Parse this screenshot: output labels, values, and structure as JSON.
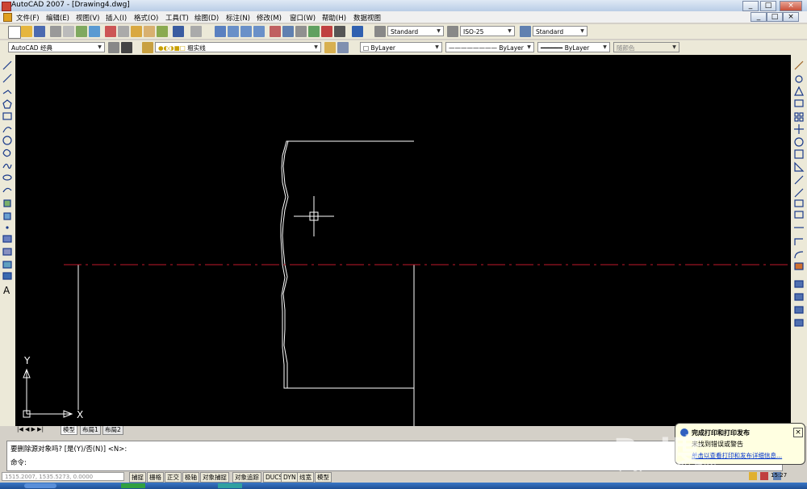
{
  "window": {
    "title": "AutoCAD 2007 - [Drawing4.dwg]",
    "minimize": "_",
    "restore": "□",
    "close": "×",
    "doc_min": "_",
    "doc_restore": "□",
    "doc_close": "×"
  },
  "menu": [
    "文件(F)",
    "编辑(E)",
    "视图(V)",
    "插入(I)",
    "格式(O)",
    "工具(T)",
    "绘图(D)",
    "标注(N)",
    "修改(M)",
    "窗口(W)",
    "帮助(H)",
    "数据视图"
  ],
  "toolbar1": {
    "text_style": "Standard",
    "dim_style": "ISO-25",
    "table_style": "Standard"
  },
  "toolbar2": {
    "workspace": "AutoCAD 经典",
    "layer": "粗实线",
    "color": "ByLayer",
    "linetype": "ByLayer",
    "lineweight": "ByLayer",
    "plot_style": "随颜色"
  },
  "tabs": [
    "模型",
    "布局1",
    "布局2"
  ],
  "ucs": {
    "y_label": "Y",
    "x_label": "X"
  },
  "command": {
    "line1": "要删除源对象吗? [是(Y)/否(N)] <N>:",
    "line2": "命令:"
  },
  "status": {
    "coords": "1515.2007, 1535.5273, 0.0000",
    "buttons": [
      "捕捉",
      "栅格",
      "正交",
      "极轴",
      "对象捕捉",
      "对象追踪",
      "DUCS",
      "DYN",
      "线宽",
      "模型"
    ]
  },
  "balloon": {
    "title": "完成打印和打印发布",
    "line2": "未找到错误或警告",
    "link": "单击以查看打印和发布详细信息..."
  },
  "clock": "15:27",
  "watermark": "Bai度",
  "watermark_sub": "jingyan.baidu.com",
  "colors": {
    "canvas": "#000000",
    "geometry": "#ffffff",
    "centerline": "#c0182a",
    "crosshair": "#ffffff"
  }
}
